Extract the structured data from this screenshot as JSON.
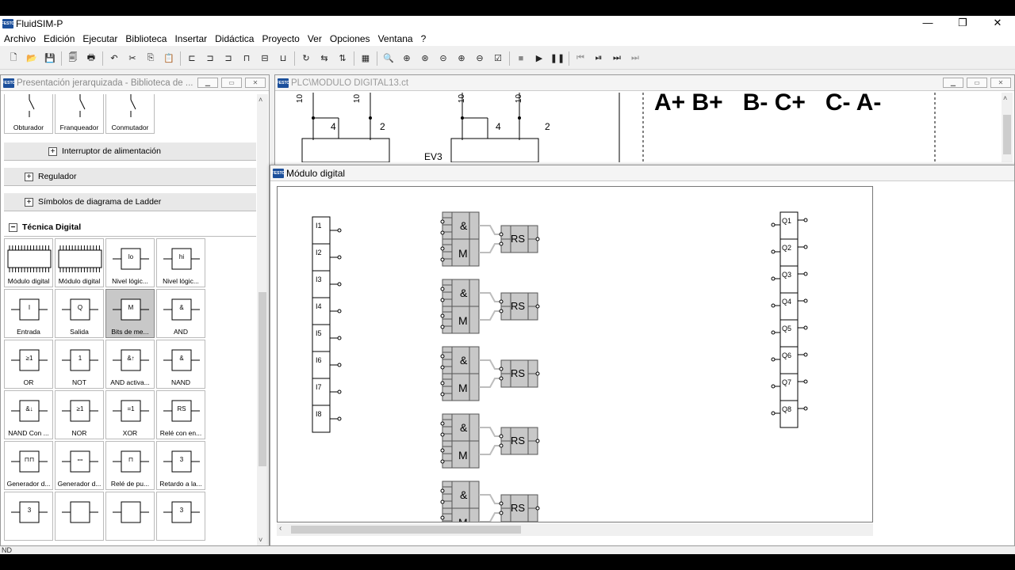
{
  "app": {
    "title": "FluidSIM-P",
    "logo": "FESTO"
  },
  "window_controls": {
    "minimize": "—",
    "maximize": "❐",
    "close": "✕"
  },
  "menu": [
    "Archivo",
    "Edición",
    "Ejecutar",
    "Biblioteca",
    "Insertar",
    "Didáctica",
    "Proyecto",
    "Ver",
    "Opciones",
    "Ventana",
    "?"
  ],
  "toolbar_icons": [
    "new-icon",
    "open-icon",
    "save-icon",
    "print-preview-icon",
    "print-icon",
    "undo-icon",
    "cut-icon",
    "copy-icon",
    "paste-icon",
    "align-left-icon",
    "align-center-icon",
    "align-right-icon",
    "align-top-icon",
    "align-middle-icon",
    "align-bottom-icon",
    "rotate-icon",
    "flip-h-icon",
    "flip-v-icon",
    "grid-icon",
    "zoom-fit-icon",
    "zoom-window-icon",
    "zoom-all-icon",
    "zoom-prev-icon",
    "zoom-in-icon",
    "zoom-out-icon",
    "check-icon",
    "stop-icon",
    "play-icon",
    "pause-icon",
    "reset-icon",
    "step-icon",
    "step-end-icon",
    "record-icon"
  ],
  "library": {
    "title": "Presentación jerarquizada - Biblioteca de ...",
    "top_items": [
      "Obturador",
      "Franqueador",
      "Conmutador"
    ],
    "groups": [
      "Interruptor de alimentación",
      "Regulador",
      "Símbolos de diagrama de Ladder"
    ],
    "open_group": "Técnica Digital",
    "cells": [
      {
        "label": "Módulo digital",
        "sym": ""
      },
      {
        "label": "Módulo digital",
        "sym": ""
      },
      {
        "label": "Nivel lógic...",
        "sym": "lo"
      },
      {
        "label": "Nivel lógic...",
        "sym": "hi"
      },
      {
        "label": "Entrada",
        "sym": "I"
      },
      {
        "label": "Salida",
        "sym": "Q"
      },
      {
        "label": "Bits de me...",
        "sym": "M"
      },
      {
        "label": "AND",
        "sym": "&"
      },
      {
        "label": "OR",
        "sym": "≥1"
      },
      {
        "label": "NOT",
        "sym": "1"
      },
      {
        "label": "AND activa...",
        "sym": "&↑"
      },
      {
        "label": "NAND",
        "sym": "&"
      },
      {
        "label": "NAND Con ...",
        "sym": "&↓"
      },
      {
        "label": "NOR",
        "sym": "≥1"
      },
      {
        "label": "XOR",
        "sym": "=1"
      },
      {
        "label": "Relé con en...",
        "sym": "RS"
      },
      {
        "label": "Generador d...",
        "sym": "⊓⊓"
      },
      {
        "label": "Generador d...",
        "sym": "ꟷ"
      },
      {
        "label": "Relé de pu...",
        "sym": "⊓"
      },
      {
        "label": "Retardo a la...",
        "sym": "3"
      },
      {
        "label": "",
        "sym": "3"
      },
      {
        "label": "",
        "sym": ""
      },
      {
        "label": "",
        "sym": ""
      },
      {
        "label": "",
        "sym": "3"
      }
    ]
  },
  "plc_window": {
    "title": "PLC\\MODULO DIGITAL13.ct",
    "sequence": "A+ B+   B- C+   C- A-",
    "labels": [
      "10",
      "10",
      "10",
      "10",
      "4",
      "2",
      "4",
      "2",
      "EV3"
    ]
  },
  "digital_module": {
    "title": "Módulo digital",
    "inputs": [
      "I1",
      "I2",
      "I3",
      "I4",
      "I5",
      "I6",
      "I7",
      "I8"
    ],
    "outputs": [
      "Q1",
      "Q2",
      "Q3",
      "Q4",
      "Q5",
      "Q6",
      "Q7",
      "Q8"
    ],
    "gate_and": "&",
    "gate_m": "M",
    "rs": "RS",
    "blocks": 5
  },
  "status": {
    "text": "ND"
  }
}
